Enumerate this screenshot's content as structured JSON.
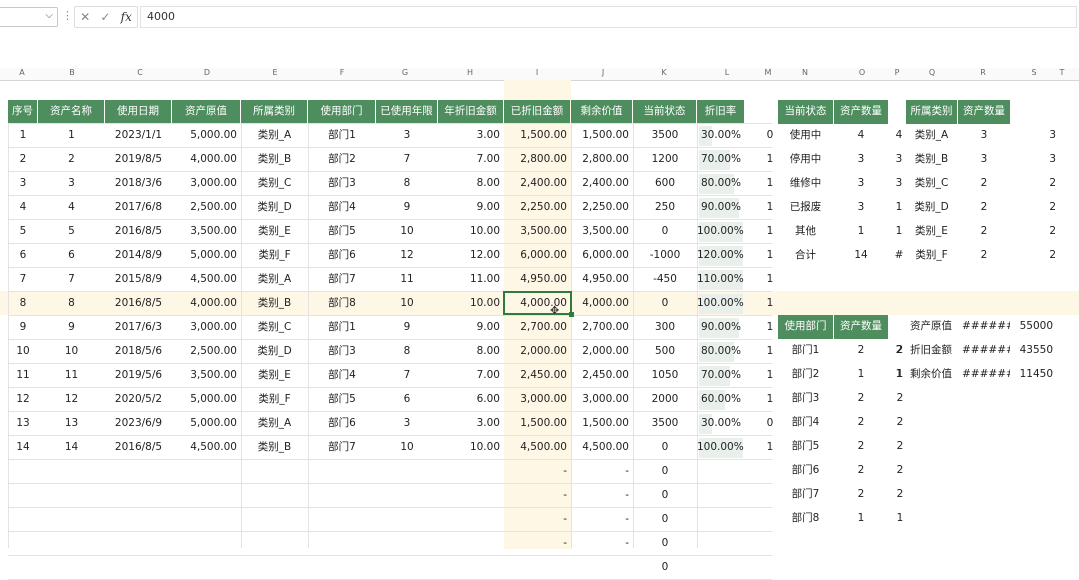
{
  "formula_bar": {
    "value": "4000",
    "fx_label": "fx",
    "cancel": "✕",
    "confirm": "✓"
  },
  "column_letters": [
    "A",
    "B",
    "C",
    "D",
    "E",
    "F",
    "G",
    "H",
    "I",
    "J",
    "K",
    "L",
    "M",
    "N",
    "O",
    "P",
    "Q",
    "R",
    "S",
    "T"
  ],
  "main_headers": [
    "序号",
    "资产名称",
    "使用日期",
    "资产原值",
    "所属类别",
    "使用部门",
    "已使用年限",
    "年折旧金额",
    "已折旧金额",
    "剩余价值",
    "当前状态",
    "折旧率"
  ],
  "main_rows": [
    [
      "1",
      "1",
      "2023/1/1",
      "5,000.00",
      "类别_A",
      "部门1",
      "3",
      "3.00",
      "1,500.00",
      "1,500.00",
      "3500",
      "30.00%"
    ],
    [
      "2",
      "2",
      "2019/8/5",
      "4,000.00",
      "类别_B",
      "部门2",
      "7",
      "7.00",
      "2,800.00",
      "2,800.00",
      "1200",
      "70.00%"
    ],
    [
      "3",
      "3",
      "2018/3/6",
      "3,000.00",
      "类别_C",
      "部门3",
      "8",
      "8.00",
      "2,400.00",
      "2,400.00",
      "600",
      "80.00%"
    ],
    [
      "4",
      "4",
      "2017/6/8",
      "2,500.00",
      "类别_D",
      "部门4",
      "9",
      "9.00",
      "2,250.00",
      "2,250.00",
      "250",
      "90.00%"
    ],
    [
      "5",
      "5",
      "2016/8/5",
      "3,500.00",
      "类别_E",
      "部门5",
      "10",
      "10.00",
      "3,500.00",
      "3,500.00",
      "0",
      "100.00%"
    ],
    [
      "6",
      "6",
      "2014/8/9",
      "5,000.00",
      "类别_F",
      "部门6",
      "12",
      "12.00",
      "6,000.00",
      "6,000.00",
      "-1000",
      "120.00%"
    ],
    [
      "7",
      "7",
      "2015/8/9",
      "4,500.00",
      "类别_A",
      "部门7",
      "11",
      "11.00",
      "4,950.00",
      "4,950.00",
      "-450",
      "110.00%"
    ],
    [
      "8",
      "8",
      "2016/8/5",
      "4,000.00",
      "类别_B",
      "部门8",
      "10",
      "10.00",
      "4,000.00",
      "4,000.00",
      "0",
      "100.00%"
    ],
    [
      "9",
      "9",
      "2017/6/3",
      "3,000.00",
      "类别_C",
      "部门1",
      "9",
      "9.00",
      "2,700.00",
      "2,700.00",
      "300",
      "90.00%"
    ],
    [
      "10",
      "10",
      "2018/5/6",
      "2,500.00",
      "类别_D",
      "部门3",
      "8",
      "8.00",
      "2,000.00",
      "2,000.00",
      "500",
      "80.00%"
    ],
    [
      "11",
      "11",
      "2019/5/6",
      "3,500.00",
      "类别_E",
      "部门4",
      "7",
      "7.00",
      "2,450.00",
      "2,450.00",
      "1050",
      "70.00%"
    ],
    [
      "12",
      "12",
      "2020/5/2",
      "5,000.00",
      "类别_F",
      "部门5",
      "6",
      "6.00",
      "3,000.00",
      "3,000.00",
      "2000",
      "60.00%"
    ],
    [
      "13",
      "13",
      "2023/6/9",
      "5,000.00",
      "类别_A",
      "部门6",
      "3",
      "3.00",
      "1,500.00",
      "1,500.00",
      "3500",
      "30.00%"
    ],
    [
      "14",
      "14",
      "2016/8/5",
      "4,500.00",
      "类别_B",
      "部门7",
      "10",
      "10.00",
      "4,500.00",
      "4,500.00",
      "0",
      "100.00%"
    ]
  ],
  "extra_rows": [
    {
      "dash": "-",
      "value": "0"
    },
    {
      "dash": "-",
      "value": "0"
    },
    {
      "dash": "-",
      "value": "0"
    },
    {
      "dash": "-",
      "value": "0"
    }
  ],
  "extra_row_last_value": "0",
  "col_n_values": [
    "0",
    "1",
    "1",
    "1",
    "1",
    "1",
    "1",
    "1",
    "1",
    "1",
    "1",
    "1",
    "0",
    "1"
  ],
  "status_table": {
    "headers": [
      "当前状态",
      "资产数量"
    ],
    "rows": [
      [
        "使用中",
        "4"
      ],
      [
        "停用中",
        "3"
      ],
      [
        "维修中",
        "3"
      ],
      [
        "已报废",
        "3"
      ],
      [
        "其他",
        "1"
      ],
      [
        "合计",
        "14"
      ]
    ],
    "side": [
      "4",
      "3",
      "3",
      "1",
      "1",
      "#"
    ]
  },
  "category_table": {
    "headers": [
      "所属类别",
      "资产数量"
    ],
    "rows": [
      [
        "类别_A",
        "3",
        "3"
      ],
      [
        "类别_B",
        "3",
        "3"
      ],
      [
        "类别_C",
        "2",
        "2"
      ],
      [
        "类别_D",
        "2",
        "2"
      ],
      [
        "类别_E",
        "2",
        "2"
      ],
      [
        "类别_F",
        "2",
        "2"
      ]
    ]
  },
  "dept_table": {
    "headers": [
      "使用部门",
      "资产数量"
    ],
    "rows": [
      [
        "部门1",
        "2",
        "2"
      ],
      [
        "部门2",
        "1",
        "1"
      ],
      [
        "部门3",
        "2",
        "2"
      ],
      [
        "部门4",
        "2",
        "2"
      ],
      [
        "部门5",
        "2",
        "2"
      ],
      [
        "部门6",
        "2",
        "2"
      ],
      [
        "部门7",
        "2",
        "2"
      ],
      [
        "部门8",
        "1",
        "1"
      ]
    ]
  },
  "summary": [
    {
      "label": "资产原值",
      "mask": "######",
      "value": "55000"
    },
    {
      "label": "折旧金额",
      "mask": "######",
      "value": "43550",
      "prefix": "2"
    },
    {
      "label": "剩余价值",
      "mask": "######",
      "value": "11450",
      "prefix": "1"
    }
  ],
  "colors": {
    "header": "#4e8d5e",
    "highlight": "#fff7e6",
    "selection": "#2e7a3f"
  }
}
